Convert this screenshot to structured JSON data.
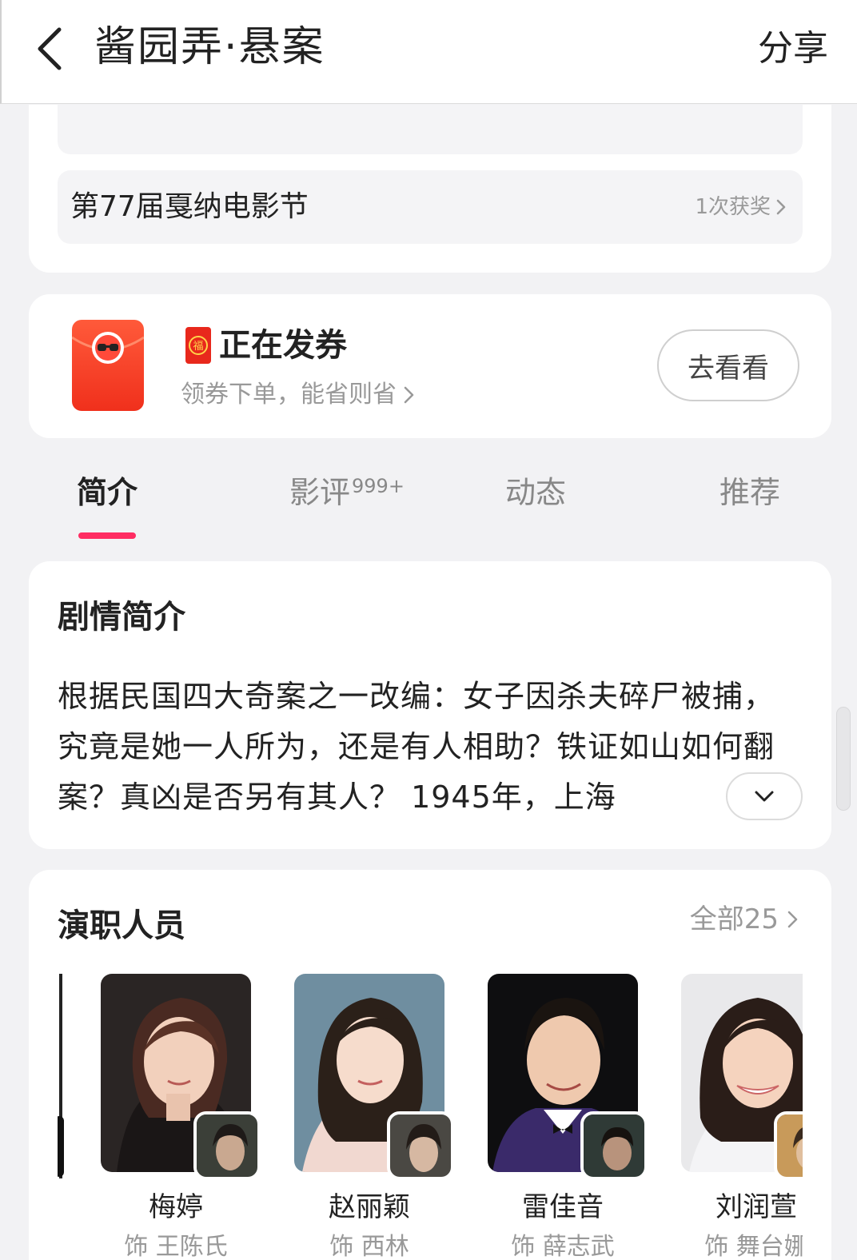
{
  "header": {
    "title": "酱园弄·悬案",
    "share_label": "分享"
  },
  "awards": {
    "festival_name": "第77届戛纳电影节",
    "count_label": "1次获奖"
  },
  "coupon": {
    "badge_char": "福",
    "title": "正在发券",
    "subtitle": "领券下单，能省则省",
    "button_label": "去看看"
  },
  "tabs": [
    {
      "label": "简介",
      "badge": "",
      "active": true
    },
    {
      "label": "影评",
      "badge": "999+",
      "active": false
    },
    {
      "label": "动态",
      "badge": "",
      "active": false
    },
    {
      "label": "推荐",
      "badge": "",
      "active": false
    }
  ],
  "synopsis": {
    "title": "剧情简介",
    "text": "根据民国四大奇案之一改编：女子因杀夫碎尸被捕，究竟是她一人所为，还是有人相助？铁证如山如何翻案？真凶是否另有其人？ 1945年，上海"
  },
  "cast": {
    "title": "演职人员",
    "all_label": "全部25",
    "members": [
      {
        "name": "梅婷",
        "role": "饰 王陈氏"
      },
      {
        "name": "赵丽颖",
        "role": "饰 西林"
      },
      {
        "name": "雷佳音",
        "role": "饰 薛志武"
      },
      {
        "name": "刘润萱",
        "role": "饰 舞台娜"
      }
    ]
  },
  "colors": {
    "accent": "#ff2d62",
    "coupon_red": "#f0301c",
    "muted_text": "#999999",
    "background": "#f2f2f4"
  },
  "icons": {
    "back": "chevron-left-icon",
    "chevron": "chevron-right-icon",
    "expand": "chevron-down-icon"
  }
}
